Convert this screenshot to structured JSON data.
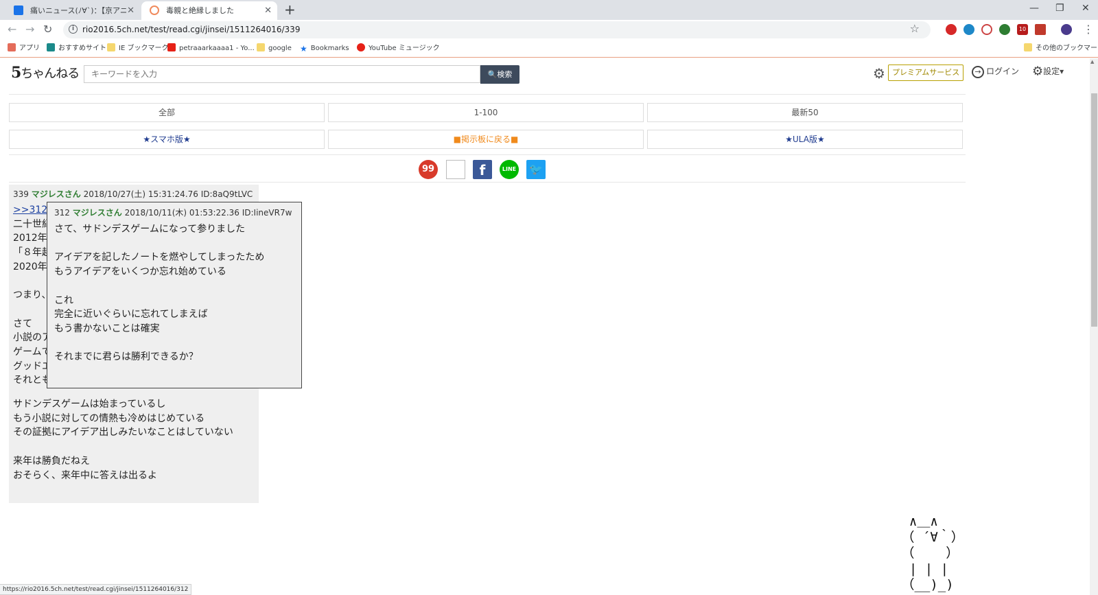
{
  "browser": {
    "tabs": [
      {
        "label": "痛いニュース(ﾉ∀`)：【京アニ放火】",
        "active": false
      },
      {
        "label": "毒親と絶縁しました",
        "active": true
      }
    ],
    "new_tab": "+",
    "window_controls": {
      "minimize": "—",
      "restore": "❐",
      "close": "✕"
    },
    "url": "rio2016.5ch.net/test/read.cgi/jinsei/1511264016/339",
    "ext_badge": "10",
    "bookmarks": [
      {
        "label": "アプリ",
        "icon": "apps-icon"
      },
      {
        "label": "おすすめサイト",
        "icon": "bing-icon"
      },
      {
        "label": "IE ブックマーク",
        "icon": "folder-icon"
      },
      {
        "label": "petraaarkaaaa1 - Yo...",
        "icon": "youtube-icon"
      },
      {
        "label": "google",
        "icon": "folder-icon"
      },
      {
        "label": "Bookmarks",
        "icon": "star-icon"
      },
      {
        "label": "YouTube ミュージック",
        "icon": "music-icon"
      }
    ],
    "other_bookmarks": "その他のブックマーク",
    "status_url": "https://rio2016.5ch.net/test/read.cgi/jinsei/1511264016/312"
  },
  "site": {
    "logo_five": "5",
    "logo_text": "ちゃんねる",
    "search_placeholder": "キーワードを入力",
    "search_button": "🔍検索",
    "premium": "プレミアムサービス",
    "login": "ログイン",
    "settings": "設定▾"
  },
  "nav": {
    "all": "全部",
    "range": "1-100",
    "latest": "最新50",
    "smartphone": "★スマホ版★",
    "back": "■掲示板に戻る■",
    "ula": "★ULA版★"
  },
  "social": {
    "s99": "99",
    "line": "LINE"
  },
  "post": {
    "number": "339",
    "name": "マジレスさん",
    "date": "2018/10/27(土) 15:31:24.76",
    "id": "ID:8aQ9tLVC",
    "anchor": ">>312",
    "body_lines_top": "\n二十世紀\n2012年\n「８年越\n2020年\n\nつまり、\n\nさて\n小説のア\nゲームで\nグッドエ\nそれとも",
    "body_lines_bottom": "サドンデスゲームは始まっているし\nもう小説に対しての情熱も冷めはじめている\nその証拠にアイデア出しみたいなことはしていない\n\n来年は勝負だねえ\nおそらく、来年中に答えは出るよ"
  },
  "popup": {
    "number": "312",
    "name": "マジレスさん",
    "date": "2018/10/11(木) 01:53:22.36",
    "id": "ID:IineVR7w",
    "body": "さて、サドンデスゲームになって参りました\n\nアイデアを記したノートを燃やしてしまったため\nもうアイデアをいくつか忘れ始めている\n\nこれ\n完全に近いぐらいに忘れてしまえば\nもう書かないことは確実\n\nそれまでに君らは勝利できるか？"
  },
  "ascii_art": "  ∧＿∧\n （ ´∀｀）\n （    ）\n  | | |\n （__)_)"
}
